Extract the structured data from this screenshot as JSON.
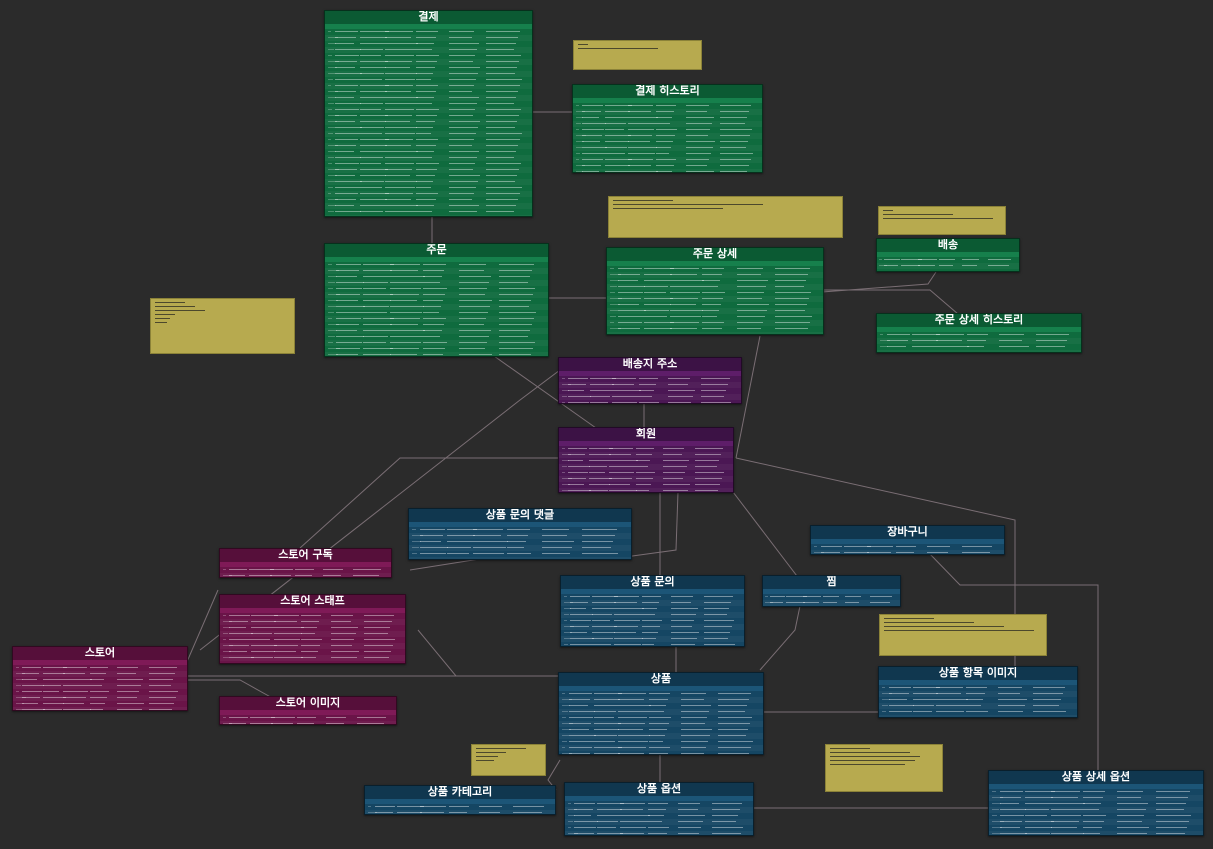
{
  "colors": {
    "background": "#2b2b2b",
    "payment_group": "#0f6b3e",
    "member_group": "#4b1754",
    "product_group": "#154663",
    "store_group": "#6a1448",
    "memo": "#b7aa4f",
    "connector": "#7a6e74"
  },
  "tables": {
    "payment": {
      "title": "결제"
    },
    "payment_history": {
      "title": "결제 히스토리"
    },
    "order": {
      "title": "주문"
    },
    "order_detail": {
      "title": "주문 상세"
    },
    "delivery": {
      "title": "배송"
    },
    "order_detail_history": {
      "title": "주문 상세 히스토리"
    },
    "shipping_address": {
      "title": "배송지 주소"
    },
    "member": {
      "title": "회원"
    },
    "product_inquiry_comment": {
      "title": "상품 문의 댓글"
    },
    "cart": {
      "title": "장바구니"
    },
    "store_subscription": {
      "title": "스토어 구독"
    },
    "store_staff": {
      "title": "스토어 스태프"
    },
    "product_inquiry": {
      "title": "상품 문의"
    },
    "wishlist": {
      "title": "찜"
    },
    "store": {
      "title": "스토어"
    },
    "product": {
      "title": "상품"
    },
    "product_list_image": {
      "title": "상품 항목 이미지"
    },
    "store_image": {
      "title": "스토어 이미지"
    },
    "product_category": {
      "title": "상품 카테고리"
    },
    "product_option": {
      "title": "상품 옵션"
    },
    "product_detail_option": {
      "title": "상품 상세 옵션"
    }
  }
}
